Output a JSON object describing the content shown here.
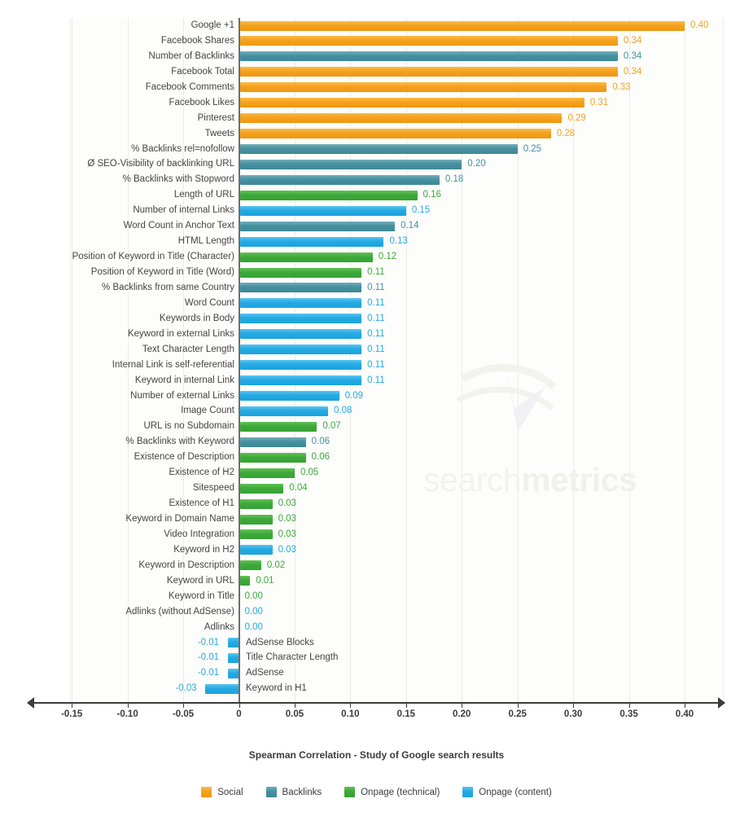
{
  "chart_data": {
    "type": "bar",
    "orientation": "horizontal",
    "title": "",
    "xlabel": "Spearman Correlation - Study of Google search results",
    "ylabel": "",
    "xlim": [
      -0.175,
      0.435
    ],
    "grid": true,
    "xticks": [
      "-0.15",
      "-0.10",
      "-0.05",
      "0",
      "0.05",
      "0.10",
      "0.15",
      "0.20",
      "0.25",
      "0.30",
      "0.35",
      "0.40"
    ],
    "xtick_values": [
      -0.15,
      -0.1,
      -0.05,
      0,
      0.05,
      0.1,
      0.15,
      0.2,
      0.25,
      0.3,
      0.35,
      0.4
    ],
    "value_format": "0.00",
    "legend_position": "bottom",
    "legend": [
      {
        "name": "Social",
        "color": "#f5a11e"
      },
      {
        "name": "Backlinks",
        "color": "#45909f"
      },
      {
        "name": "Onpage (technical)",
        "color": "#3da93b"
      },
      {
        "name": "Onpage (content)",
        "color": "#25aae2"
      }
    ],
    "categories": [
      "Google +1",
      "Facebook Shares",
      "Number of Backlinks",
      "Facebook Total",
      "Facebook Comments",
      "Facebook Likes",
      "Pinterest",
      "Tweets",
      "% Backlinks rel=nofollow",
      "Ø SEO-Visibility of backlinking URL",
      "% Backlinks with Stopword",
      "Length of URL",
      "Number of internal Links",
      "Word Count in Anchor Text",
      "HTML Length",
      "Position of Keyword in Title (Character)",
      "Position of Keyword in Title (Word)",
      "% Backlinks from same Country",
      "Word Count",
      "Keywords in Body",
      "Keyword in external Links",
      "Text Character Length",
      "Internal Link is self-referential",
      "Keyword in internal Link",
      "Number of external Links",
      "Image Count",
      "URL is no Subdomain",
      "% Backlinks with Keyword",
      "Existence of Description",
      "Existence of H2",
      "Sitespeed",
      "Existence of H1",
      "Keyword in Domain Name",
      "Video Integration",
      "Keyword in H2",
      "Keyword in Description",
      "Keyword in URL",
      "Keyword in Title",
      "Adlinks (without AdSense)",
      "Adlinks",
      "AdSense Blocks",
      "Title Character Length",
      "AdSense",
      "Keyword in H1"
    ],
    "values": [
      0.4,
      0.34,
      0.34,
      0.34,
      0.33,
      0.31,
      0.29,
      0.28,
      0.25,
      0.2,
      0.18,
      0.16,
      0.15,
      0.14,
      0.13,
      0.12,
      0.11,
      0.11,
      0.11,
      0.11,
      0.11,
      0.11,
      0.11,
      0.11,
      0.09,
      0.08,
      0.07,
      0.06,
      0.06,
      0.05,
      0.04,
      0.03,
      0.03,
      0.03,
      0.03,
      0.02,
      0.01,
      0.0,
      0.0,
      0.0,
      -0.01,
      -0.01,
      -0.01,
      -0.03
    ],
    "value_labels": [
      "0.40",
      "0.34",
      "0.34",
      "0.34",
      "0.33",
      "0.31",
      "0.29",
      "0.28",
      "0.25",
      "0.20",
      "0.18",
      "0.16",
      "0.15",
      "0.14",
      "0.13",
      "0.12",
      "0.11",
      "0.11",
      "0.11",
      "0.11",
      "0.11",
      "0.11",
      "0.11",
      "0.11",
      "0.09",
      "0.08",
      "0.07",
      "0.06",
      "0.06",
      "0.05",
      "0.04",
      "0.03",
      "0.03",
      "0.03",
      "0.03",
      "0.02",
      "0.01",
      "0.00",
      "0.00",
      "0.00",
      "-0.01",
      "-0.01",
      "-0.01",
      "-0.03"
    ],
    "groups": [
      "Social",
      "Social",
      "Backlinks",
      "Social",
      "Social",
      "Social",
      "Social",
      "Social",
      "Backlinks",
      "Backlinks",
      "Backlinks",
      "Onpage (technical)",
      "Onpage (content)",
      "Backlinks",
      "Onpage (content)",
      "Onpage (technical)",
      "Onpage (technical)",
      "Backlinks",
      "Onpage (content)",
      "Onpage (content)",
      "Onpage (content)",
      "Onpage (content)",
      "Onpage (content)",
      "Onpage (content)",
      "Onpage (content)",
      "Onpage (content)",
      "Onpage (technical)",
      "Backlinks",
      "Onpage (technical)",
      "Onpage (technical)",
      "Onpage (technical)",
      "Onpage (technical)",
      "Onpage (technical)",
      "Onpage (technical)",
      "Onpage (content)",
      "Onpage (technical)",
      "Onpage (technical)",
      "Onpage (technical)",
      "Onpage (content)",
      "Onpage (content)",
      "Onpage (content)",
      "Onpage (content)",
      "Onpage (content)",
      "Onpage (content)"
    ]
  },
  "watermark": {
    "text_light": "search",
    "text_bold": "metrics"
  }
}
